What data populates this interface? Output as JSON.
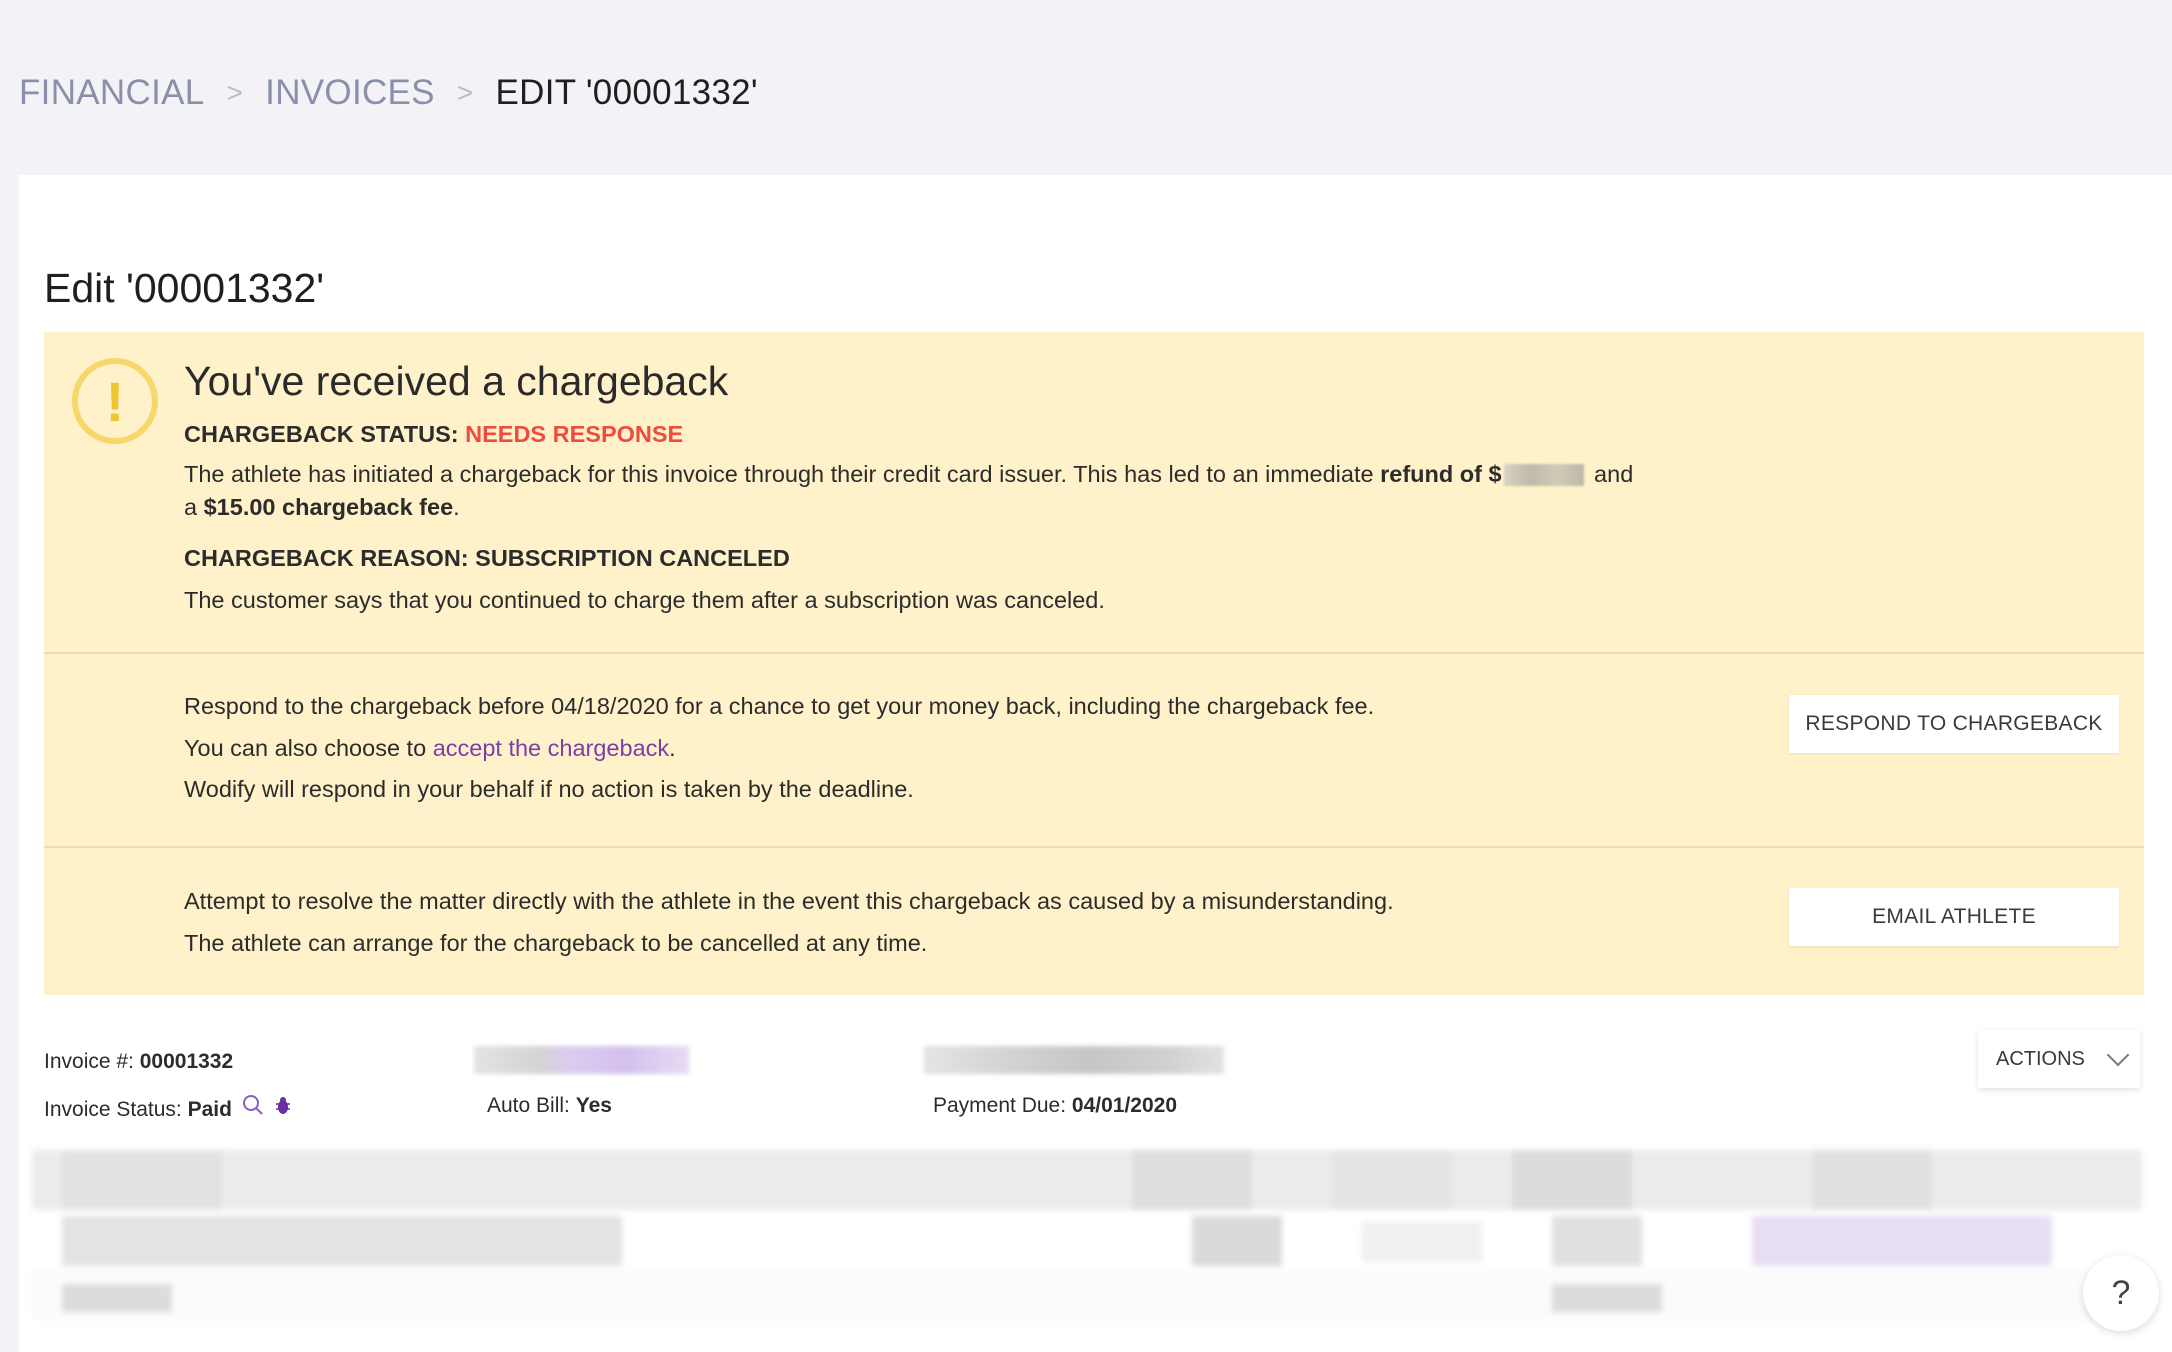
{
  "breadcrumb": {
    "items": [
      "FINANCIAL",
      "INVOICES"
    ],
    "current": "EDIT '00001332'"
  },
  "page": {
    "title": "Edit '00001332'"
  },
  "alert": {
    "heading": "You've received a chargeback",
    "status_label": "CHARGEBACK STATUS:",
    "status_value": "NEEDS RESPONSE",
    "status_color": "#ef4b3f",
    "desc_part1": "The athlete has initiated a chargeback for this invoice through their credit card issuer. This has led to an immediate ",
    "desc_refund": "refund of $",
    "desc_part2": " and",
    "desc_line2_prefix": "a ",
    "desc_fee": "$15.00 chargeback fee",
    "desc_line2_suffix": ".",
    "reason_label": "CHARGEBACK REASON: SUBSCRIPTION CANCELED",
    "reason_text": "The customer says that you continued to charge them after a subscription was canceled.",
    "respond": {
      "line1": "Respond to the chargeback before 04/18/2020 for a chance to get your money back, including the chargeback fee.",
      "line2_prefix": "You can also choose to ",
      "line2_link": "accept the chargeback",
      "line2_suffix": ".",
      "line3": "Wodify will respond in your behalf if no action is taken by the deadline.",
      "button": "RESPOND TO CHARGEBACK"
    },
    "email": {
      "line1": "Attempt to resolve the matter directly with the athlete in the event this chargeback as caused by a misunderstanding.",
      "line2": "The athlete can arrange for the chargeback to be cancelled at any time.",
      "button": "EMAIL ATHLETE"
    },
    "icon": "warning-icon",
    "bg_color": "#fff1c9"
  },
  "invoice": {
    "number_label": "Invoice #:",
    "number_value": "00001332",
    "status_label": "Invoice Status:",
    "status_value": "Paid",
    "auto_bill_label": "Auto Bill:",
    "auto_bill_value": "Yes",
    "payment_due_label": "Payment Due:",
    "payment_due_value": "04/01/2020",
    "status_icons": [
      "search-icon",
      "bug-icon"
    ]
  },
  "actions": {
    "label": "ACTIONS"
  },
  "help": {
    "label": "?"
  },
  "colors": {
    "accent_purple": "#7a3fa8",
    "breadcrumb_muted": "#8b90aa"
  }
}
